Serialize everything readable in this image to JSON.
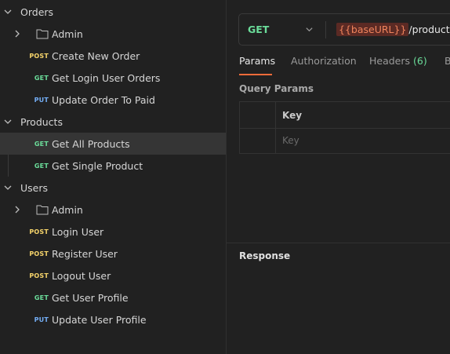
{
  "sidebar": {
    "orders": {
      "label": "Orders",
      "admin_label": "Admin",
      "items": [
        {
          "method": "POST",
          "label": "Create New Order"
        },
        {
          "method": "GET",
          "label": "Get Login User Orders"
        },
        {
          "method": "PUT",
          "label": "Update Order To Paid"
        }
      ]
    },
    "products": {
      "label": "Products",
      "items": [
        {
          "method": "GET",
          "label": "Get All Products"
        },
        {
          "method": "GET",
          "label": "Get Single Product"
        }
      ]
    },
    "users": {
      "label": "Users",
      "admin_label": "Admin",
      "items": [
        {
          "method": "POST",
          "label": "Login User"
        },
        {
          "method": "POST",
          "label": "Register User"
        },
        {
          "method": "POST",
          "label": "Logout User"
        },
        {
          "method": "GET",
          "label": "Get User Profile"
        },
        {
          "method": "PUT",
          "label": "Update User Profile"
        }
      ]
    }
  },
  "request": {
    "method": "GET",
    "url_variable": "{{baseURL}}",
    "url_path": "/products"
  },
  "tabs": {
    "params": "Params",
    "authorization": "Authorization",
    "headers": "Headers",
    "headers_count": "(6)",
    "body": "B"
  },
  "query_params": {
    "title": "Query Params",
    "key_header": "Key",
    "key_placeholder": "Key"
  },
  "response": {
    "title": "Response"
  },
  "colors": {
    "post": "#f5d36a",
    "get": "#6bdd9a",
    "put": "#74aef6",
    "accent": "#f26b3a",
    "selected_row": "#353535"
  }
}
